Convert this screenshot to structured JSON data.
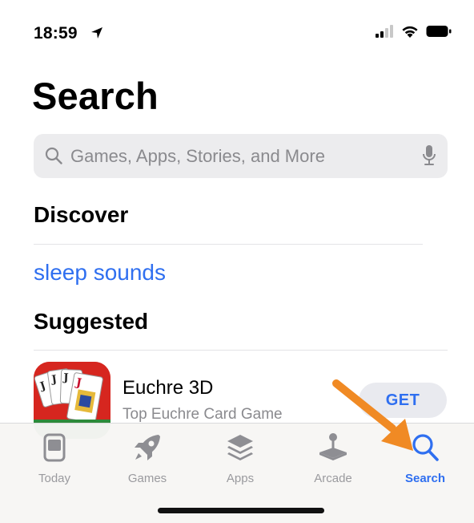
{
  "status_bar": {
    "time": "18:59",
    "icons": [
      "location-arrow-icon",
      "cellular-signal-icon",
      "wifi-icon",
      "battery-icon"
    ]
  },
  "header": {
    "title": "Search"
  },
  "search": {
    "placeholder": "Games, Apps, Stories, and More",
    "value": ""
  },
  "discover": {
    "title": "Discover",
    "items": [
      {
        "label": "sleep sounds"
      }
    ]
  },
  "suggested": {
    "title": "Suggested",
    "apps": [
      {
        "name": "Euchre 3D",
        "subtitle": "Top Euchre Card Game",
        "button_label": "GET"
      }
    ]
  },
  "tab_bar": {
    "active": "Search",
    "tabs": [
      {
        "label": "Today",
        "icon": "today-icon"
      },
      {
        "label": "Games",
        "icon": "rocket-icon"
      },
      {
        "label": "Apps",
        "icon": "apps-stack-icon"
      },
      {
        "label": "Arcade",
        "icon": "joystick-icon"
      },
      {
        "label": "Search",
        "icon": "search-icon"
      }
    ]
  },
  "colors": {
    "accent": "#2f6ff0",
    "annotation": "#f08a24",
    "app_icon_bg": "#d6261f",
    "search_bg": "#ececee"
  }
}
